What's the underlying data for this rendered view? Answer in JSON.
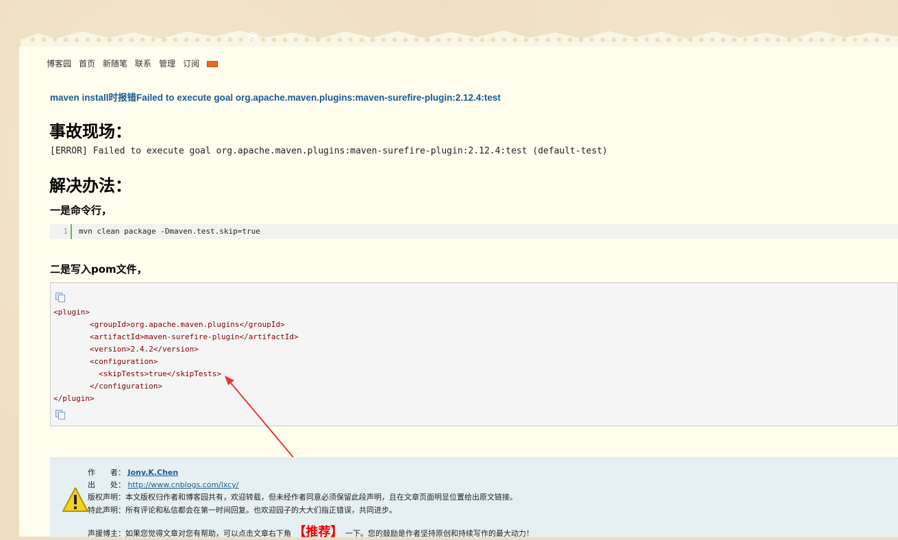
{
  "nav": {
    "items": [
      "博客园",
      "首页",
      "新随笔",
      "联系",
      "管理",
      "订阅"
    ],
    "rss_icon": "rss-icon"
  },
  "post": {
    "title": "maven install时报错Failed to execute goal org.apache.maven.plugins:maven-surefire-plugin:2.12.4:test",
    "section1_heading": "事故现场：",
    "error_text": "[ERROR] Failed to execute goal org.apache.maven.plugins:maven-surefire-plugin:2.12.4:test (default-test)",
    "section2_heading": "解决办法：",
    "method1_heading": "一是命令行，",
    "code1": {
      "line_number": "1",
      "text": "mvn clean package -Dmaven.test.skip=true"
    },
    "method2_heading": "二是写入pom文件，",
    "code2_lines": [
      "<plugin>",
      "        <groupId>org.apache.maven.plugins</groupId>",
      "        <artifactId>maven-surefire-plugin</artifactId>",
      "        <version>2.4.2</version>",
      "        <configuration>",
      "          <skipTests>true</skipTests>",
      "        </configuration>",
      "</plugin>"
    ]
  },
  "footer": {
    "author_label": "作　　者：",
    "author_name": "Jony.K.Chen",
    "source_label": "出　　处：",
    "source_url": "http://www.cnblogs.com/lxcy/",
    "copyright": "版权声明：本文版权归作者和博客园共有，欢迎转载，但未经作者同意必须保留此段声明，且在文章页面明显位置给出原文链接。",
    "notice": "特此声明：所有评论和私信都会在第一时间回复。也欢迎园子的大大们指正错误，共同进步。",
    "support_prefix": "声援博主：如果您觉得文章对您有帮助，可以点击文章右下角",
    "recommend": "【推荐】",
    "support_suffix": "一下。您的鼓励是作者坚持原创和持续写作的最大动力！",
    "warning_icon": "warning-icon"
  }
}
